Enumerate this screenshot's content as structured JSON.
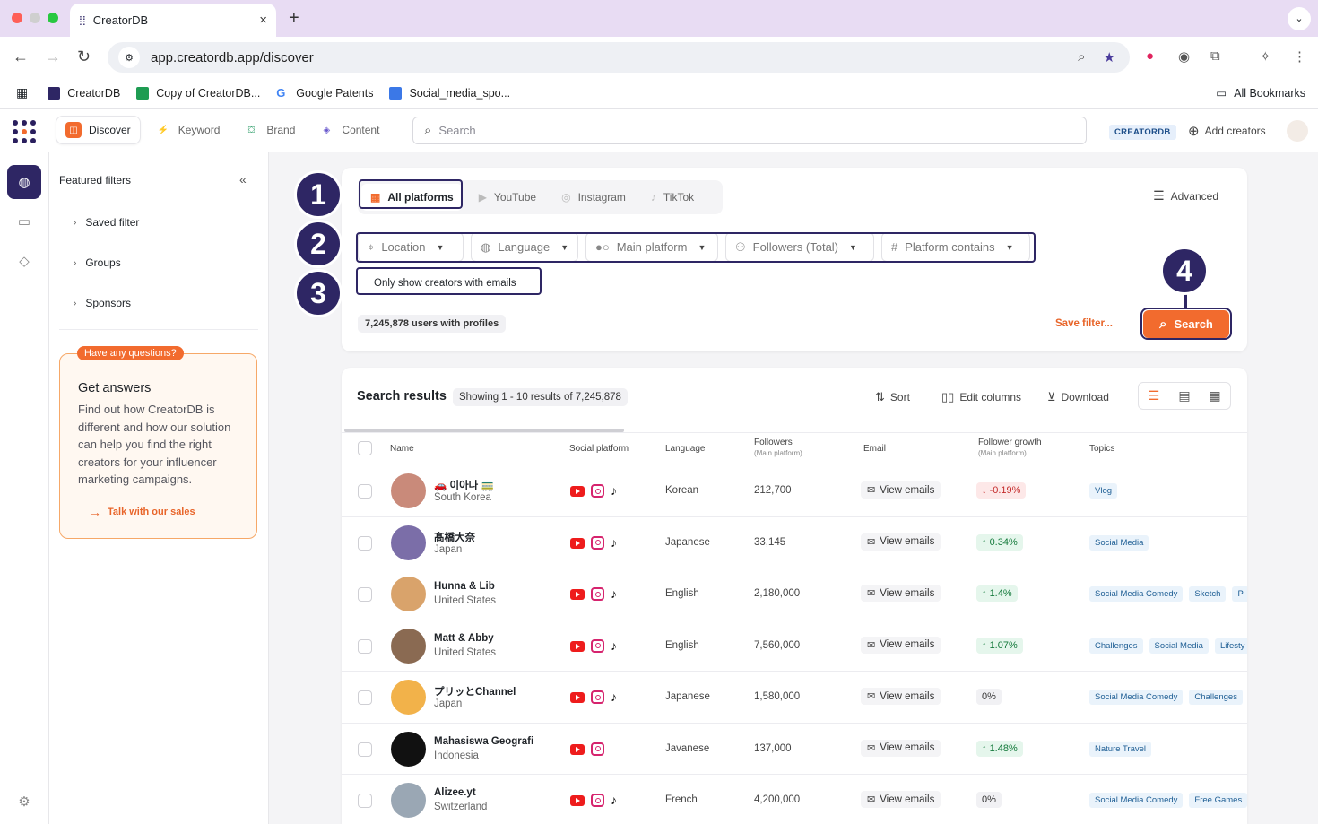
{
  "browser": {
    "tab_title": "CreatorDB",
    "url": "app.creatordb.app/discover",
    "bookmarks": [
      "CreatorDB",
      "Copy of CreatorDB...",
      "Google Patents",
      "Social_media_spo..."
    ],
    "all_bookmarks": "All Bookmarks"
  },
  "header": {
    "tabs": [
      "Discover",
      "Keyword",
      "Brand",
      "Content"
    ],
    "search_placeholder": "Search",
    "brand_chip": "CREATORDB",
    "add_creators": "Add creators"
  },
  "sidebar": {
    "title": "Featured filters",
    "items": [
      "Saved filter",
      "Groups",
      "Sponsors"
    ],
    "help": {
      "badge": "Have any questions?",
      "title": "Get answers",
      "body": "Find out how CreatorDB is different and how our solution can help you find the right creators for your influencer marketing campaigns.",
      "link": "Talk with our sales"
    }
  },
  "filters": {
    "platforms": [
      "All platforms",
      "YouTube",
      "Instagram",
      "TikTok"
    ],
    "advanced": "Advanced",
    "dropdowns": [
      "Location",
      "Language",
      "Main platform",
      "Followers (Total)",
      "Platform contains"
    ],
    "email_option": "Only show creators with emails",
    "users_count": "7,245,878 users with profiles",
    "save_filter": "Save filter...",
    "search_button": "Search"
  },
  "callouts": [
    "1",
    "2",
    "3",
    "4"
  ],
  "results": {
    "title": "Search results",
    "showing": "Showing 1 - 10 results of 7,245,878",
    "sort": "Sort",
    "edit_columns": "Edit columns",
    "download": "Download",
    "columns": {
      "name": "Name",
      "social": "Social platform",
      "language": "Language",
      "followers": "Followers",
      "followers_sub": "(Main platform)",
      "email": "Email",
      "growth": "Follower growth",
      "growth_sub": "(Main platform)",
      "topics": "Topics"
    },
    "view_emails": "View emails",
    "rows": [
      {
        "name": "🚗 이아나 🚃",
        "location": "South Korea",
        "language": "Korean",
        "followers": "212,700",
        "growth": "-0.19%",
        "trend": "down",
        "tiktok": true,
        "topics": [
          "Vlog"
        ],
        "avatar": "#c98a7a"
      },
      {
        "name": "髙橋大奈",
        "location": "Japan",
        "language": "Japanese",
        "followers": "33,145",
        "growth": "0.34%",
        "trend": "up",
        "tiktok": true,
        "topics": [
          "Social Media"
        ],
        "avatar": "#7b6ea8"
      },
      {
        "name": "Hunna & Lib",
        "location": "United States",
        "language": "English",
        "followers": "2,180,000",
        "growth": "1.4%",
        "trend": "up",
        "tiktok": true,
        "topics": [
          "Social Media Comedy",
          "Sketch",
          "P"
        ],
        "avatar": "#d9a36b"
      },
      {
        "name": "Matt & Abby",
        "location": "United States",
        "language": "English",
        "followers": "7,560,000",
        "growth": "1.07%",
        "trend": "up",
        "tiktok": true,
        "topics": [
          "Challenges",
          "Social Media",
          "Lifesty"
        ],
        "avatar": "#8a6a52"
      },
      {
        "name": "プリッとChannel",
        "location": "Japan",
        "language": "Japanese",
        "followers": "1,580,000",
        "growth": "0%",
        "trend": "flat",
        "tiktok": true,
        "topics": [
          "Social Media Comedy",
          "Challenges"
        ],
        "avatar": "#f2b24a"
      },
      {
        "name": "Mahasiswa Geografi",
        "location": "Indonesia",
        "language": "Javanese",
        "followers": "137,000",
        "growth": "1.48%",
        "trend": "up",
        "tiktok": false,
        "topics": [
          "Nature Travel"
        ],
        "avatar": "#111111"
      },
      {
        "name": "Alizee.yt",
        "location": "Switzerland",
        "language": "French",
        "followers": "4,200,000",
        "growth": "0%",
        "trend": "flat",
        "tiktok": true,
        "topics": [
          "Social Media Comedy",
          "Free Games"
        ],
        "avatar": "#9aa7b4"
      }
    ]
  },
  "colors": {
    "accent": "#f26b2e",
    "brand": "#2e2664"
  }
}
